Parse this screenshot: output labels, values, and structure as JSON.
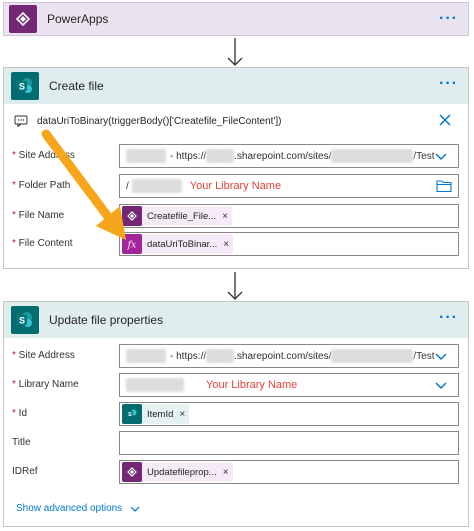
{
  "powerapps": {
    "title": "PowerApps",
    "more": "···"
  },
  "create_file": {
    "title": "Create file",
    "more": "···",
    "expression": "dataUriToBinary(triggerBody()['Createfile_FileContent'])",
    "fields": {
      "site_address": {
        "label": "Site Address",
        "prefix": "- https://",
        "mid": ".sharepoint.com/sites/",
        "suffix": "/Test"
      },
      "folder_path": {
        "label": "Folder Path",
        "prefix": "/",
        "note": "Your Library Name"
      },
      "file_name": {
        "label": "File Name",
        "token": "Createfile_File..."
      },
      "file_content": {
        "label": "File Content",
        "token": "dataUriToBinar..."
      }
    }
  },
  "update_file": {
    "title": "Update file properties",
    "more": "···",
    "fields": {
      "site_address": {
        "label": "Site Address",
        "prefix": "- https://",
        "mid": ".sharepoint.com/sites/",
        "suffix": "/Test"
      },
      "library_name": {
        "label": "Library Name",
        "note": "Your Library Name"
      },
      "id": {
        "label": "Id",
        "token": "ItemId"
      },
      "title": {
        "label": "Title"
      },
      "idref": {
        "label": "IDRef",
        "token": "Updatefileprop..."
      }
    },
    "advanced": "Show advanced options"
  },
  "colors": {
    "accent": "#0078d4",
    "powerapps": "#742774",
    "sharepoint": "#036c70",
    "arrow": "#f7a61c",
    "note": "#e3423a"
  }
}
